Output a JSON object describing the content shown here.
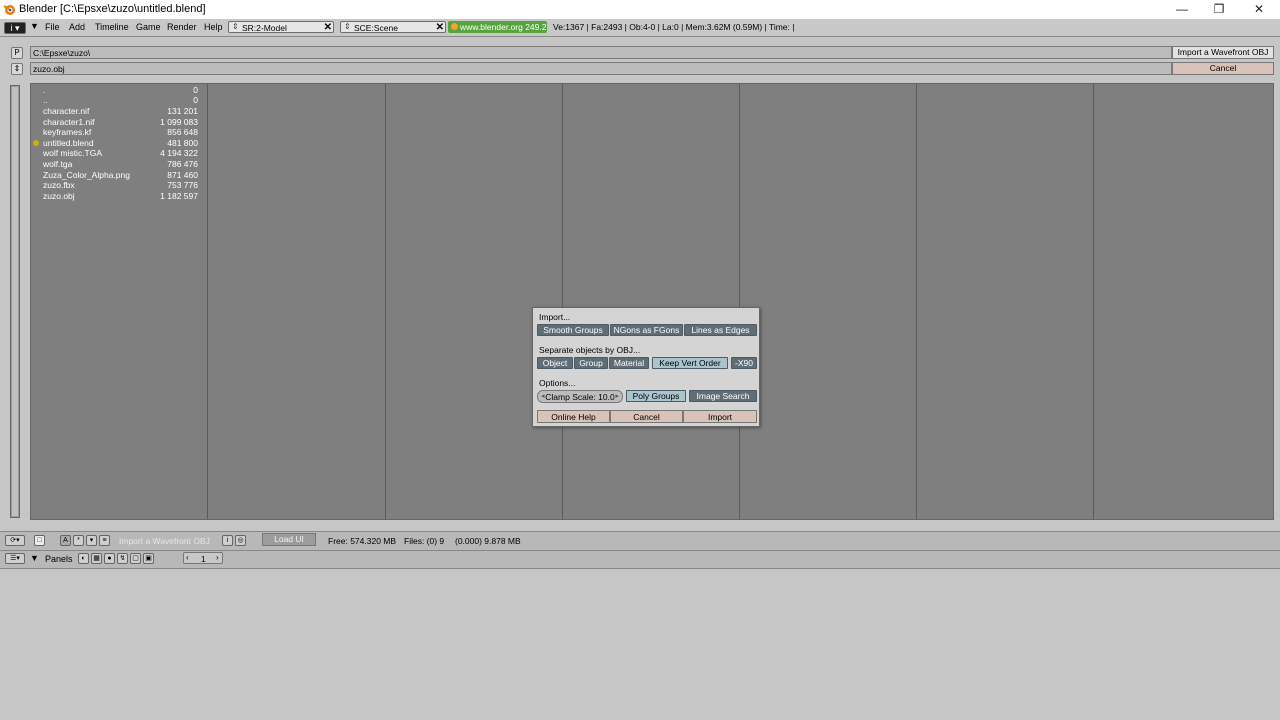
{
  "window": {
    "title": "Blender [C:\\Epsxe\\zuzo\\untitled.blend]",
    "controls": {
      "minimize": "—",
      "maximize": "❐",
      "close": "✕"
    }
  },
  "info_header": {
    "menus": [
      "File",
      "Add",
      "Timeline",
      "Game",
      "Render",
      "Help"
    ],
    "screen_field": "SR:2-Model",
    "scene_field": "SCE:Scene",
    "url": "www.blender.org 249.2",
    "stats": "Ve:1367 | Fa:2493 | Ob:4-0 | La:0  | Mem:3.62M (0.59M)  | Time: |"
  },
  "file_browser": {
    "path": "C:\\Epsxe\\zuzo\\",
    "filename": "zuzo.obj",
    "parent_button": "P",
    "action_button": "Import a Wavefront OBJ",
    "cancel_button": "Cancel",
    "files": [
      {
        "name": ".",
        "size": "0"
      },
      {
        "name": "..",
        "size": "0"
      },
      {
        "name": "character.nif",
        "size": "131 201"
      },
      {
        "name": "character1.nif",
        "size": "1 099 083"
      },
      {
        "name": "keyframes.kf",
        "size": "856 648"
      },
      {
        "name": "untitled.blend",
        "size": "481 800"
      },
      {
        "name": "wolf mistic.TGA",
        "size": "4 194 322"
      },
      {
        "name": "wolf.tga",
        "size": "786 476"
      },
      {
        "name": "Zuza_Color_Alpha.png",
        "size": "871 460"
      },
      {
        "name": "zuzo.fbx",
        "size": "753 776"
      },
      {
        "name": "zuzo.obj",
        "size": "1 182 597"
      }
    ]
  },
  "bottom_header": {
    "title_faded": "Import a Wavefront OBJ",
    "load_ui": "Load UI",
    "free": "Free: 574.320 MB",
    "files": "Files: (0) 9",
    "size": "(0.000) 9.878 MB"
  },
  "panels_header": {
    "label": "Panels",
    "page": "1"
  },
  "dialog": {
    "import_label": "Import...",
    "import_options": [
      {
        "label": "Smooth Groups",
        "on": false
      },
      {
        "label": "NGons as FGons",
        "on": false
      },
      {
        "label": "Lines as Edges",
        "on": false
      }
    ],
    "separate_label": "Separate objects by OBJ...",
    "separate_options": [
      {
        "label": "Object",
        "on": false
      },
      {
        "label": "Group",
        "on": false
      },
      {
        "label": "Material",
        "on": false
      },
      {
        "label": "Keep Vert Order",
        "on": true
      },
      {
        "label": "-X90",
        "on": false
      }
    ],
    "options_label": "Options...",
    "clamp_scale": "Clamp Scale: 10.0",
    "poly_groups": "Poly Groups",
    "image_search": "Image Search",
    "online_help": "Online Help",
    "cancel": "Cancel",
    "import": "Import"
  }
}
